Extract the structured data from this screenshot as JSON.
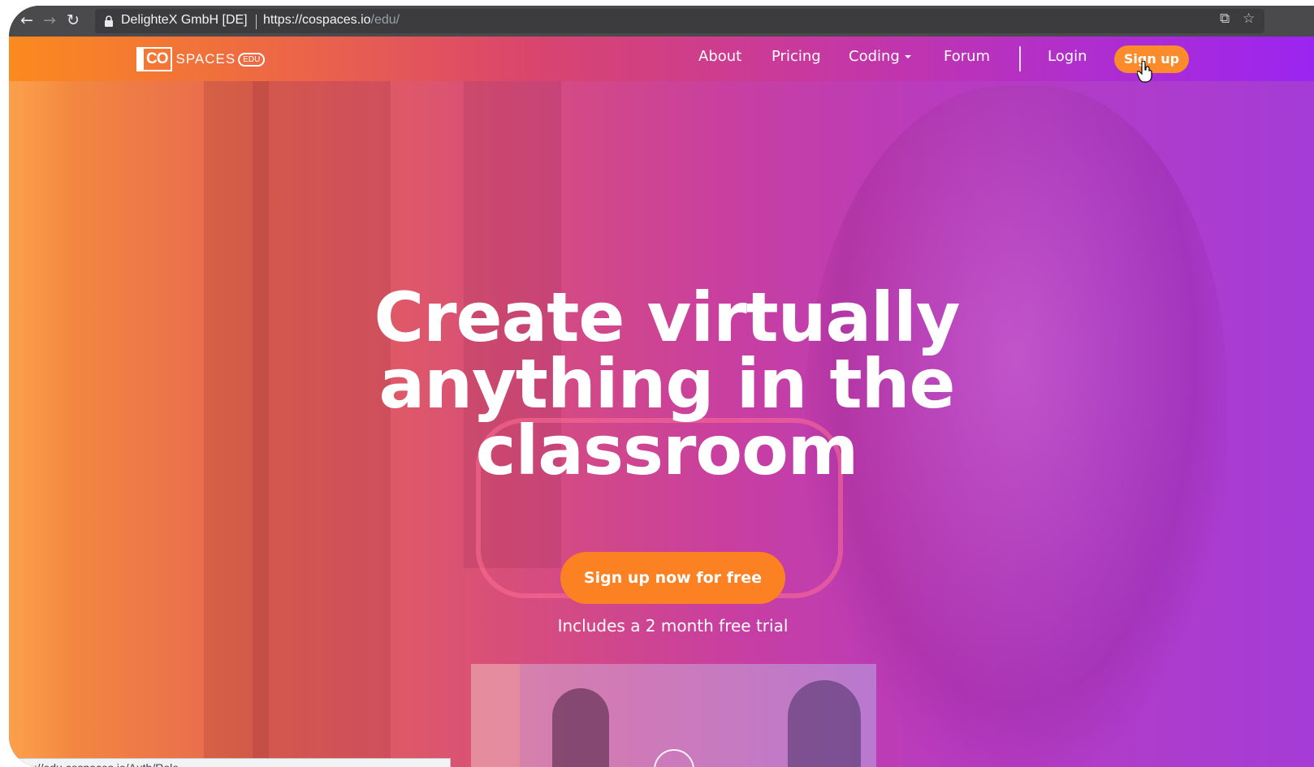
{
  "browser": {
    "org_label": "DelighteX GmbH [DE]",
    "url_host": "https://cospaces.io",
    "url_path": "/edu/",
    "status_url": "ps://edu.cospaces.io/Auth/Role",
    "icons": [
      "back-icon",
      "forward-icon",
      "reload-icon",
      "lock-icon",
      "translate-icon",
      "star-icon"
    ]
  },
  "nav": {
    "logo_co": "CO",
    "logo_spaces": "SPACES",
    "logo_edu": "EDU",
    "about": "About",
    "pricing": "Pricing",
    "coding": "Coding",
    "forum": "Forum",
    "login": "Login",
    "signup": "Sign up"
  },
  "hero": {
    "title": "Create virtually anything in the classroom",
    "cta": "Sign up now for free",
    "trial": "Includes a 2 month free trial"
  },
  "colors": {
    "accent_orange": "#fb8123",
    "gradient_start": "#fb8a1f",
    "gradient_end": "#9b25f0"
  }
}
